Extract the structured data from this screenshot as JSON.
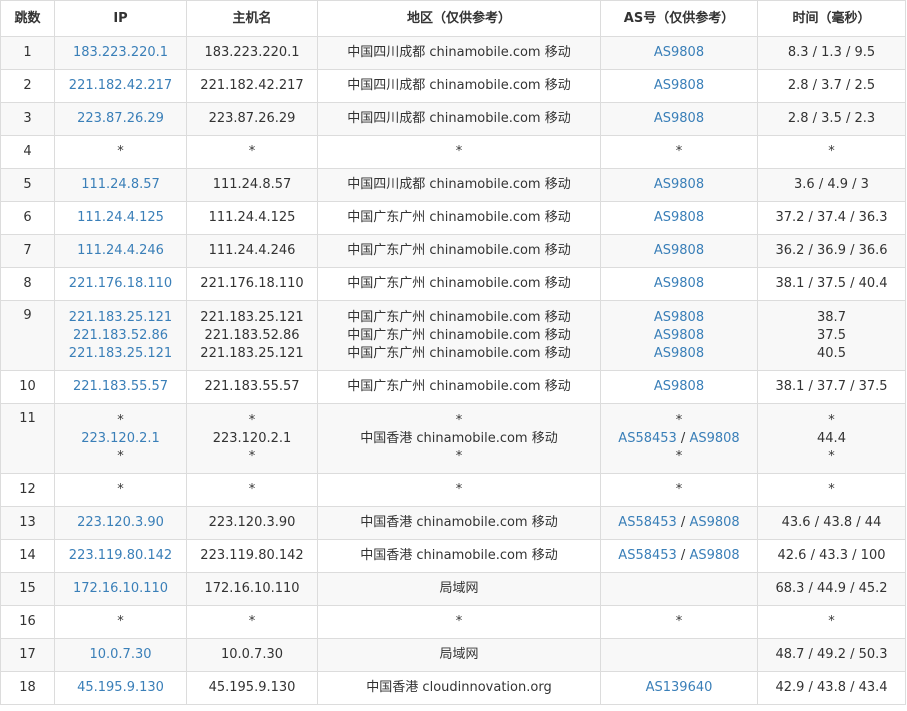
{
  "headers": [
    "跳数",
    "IP",
    "主机名",
    "地区（仅供参考）",
    "AS号（仅供参考）",
    "时间（毫秒）"
  ],
  "rows": [
    {
      "hop": "1",
      "lines": [
        {
          "ip": "183.223.220.1",
          "host": "183.223.220.1",
          "region": "中国四川成都 chinamobile.com 移动",
          "as": [
            "AS9808"
          ],
          "time": "8.3 / 1.3 / 9.5"
        }
      ]
    },
    {
      "hop": "2",
      "lines": [
        {
          "ip": "221.182.42.217",
          "host": "221.182.42.217",
          "region": "中国四川成都 chinamobile.com 移动",
          "as": [
            "AS9808"
          ],
          "time": "2.8 / 3.7 / 2.5"
        }
      ]
    },
    {
      "hop": "3",
      "lines": [
        {
          "ip": "223.87.26.29",
          "host": "223.87.26.29",
          "region": "中国四川成都 chinamobile.com 移动",
          "as": [
            "AS9808"
          ],
          "time": "2.8 / 3.5 / 2.3"
        }
      ]
    },
    {
      "hop": "4",
      "lines": [
        {
          "ip": "*",
          "host": "*",
          "region": "*",
          "as": [
            "*"
          ],
          "time": "*"
        }
      ]
    },
    {
      "hop": "5",
      "lines": [
        {
          "ip": "111.24.8.57",
          "host": "111.24.8.57",
          "region": "中国四川成都 chinamobile.com 移动",
          "as": [
            "AS9808"
          ],
          "time": "3.6 / 4.9 / 3"
        }
      ]
    },
    {
      "hop": "6",
      "lines": [
        {
          "ip": "111.24.4.125",
          "host": "111.24.4.125",
          "region": "中国广东广州 chinamobile.com 移动",
          "as": [
            "AS9808"
          ],
          "time": "37.2 / 37.4 / 36.3"
        }
      ]
    },
    {
      "hop": "7",
      "lines": [
        {
          "ip": "111.24.4.246",
          "host": "111.24.4.246",
          "region": "中国广东广州 chinamobile.com 移动",
          "as": [
            "AS9808"
          ],
          "time": "36.2 / 36.9 / 36.6"
        }
      ]
    },
    {
      "hop": "8",
      "lines": [
        {
          "ip": "221.176.18.110",
          "host": "221.176.18.110",
          "region": "中国广东广州 chinamobile.com 移动",
          "as": [
            "AS9808"
          ],
          "time": "38.1 / 37.5 / 40.4"
        }
      ]
    },
    {
      "hop": "9",
      "lines": [
        {
          "ip": "221.183.25.121",
          "host": "221.183.25.121",
          "region": "中国广东广州 chinamobile.com 移动",
          "as": [
            "AS9808"
          ],
          "time": "38.7"
        },
        {
          "ip": "221.183.52.86",
          "host": "221.183.52.86",
          "region": "中国广东广州 chinamobile.com 移动",
          "as": [
            "AS9808"
          ],
          "time": "37.5"
        },
        {
          "ip": "221.183.25.121",
          "host": "221.183.25.121",
          "region": "中国广东广州 chinamobile.com 移动",
          "as": [
            "AS9808"
          ],
          "time": "40.5"
        }
      ]
    },
    {
      "hop": "10",
      "lines": [
        {
          "ip": "221.183.55.57",
          "host": "221.183.55.57",
          "region": "中国广东广州 chinamobile.com 移动",
          "as": [
            "AS9808"
          ],
          "time": "38.1 / 37.7 / 37.5"
        }
      ]
    },
    {
      "hop": "11",
      "lines": [
        {
          "ip": "*",
          "host": "*",
          "region": "*",
          "as": [
            "*"
          ],
          "time": "*"
        },
        {
          "ip": "223.120.2.1",
          "host": "223.120.2.1",
          "region": "中国香港 chinamobile.com 移动",
          "as": [
            "AS58453",
            "AS9808"
          ],
          "time": "44.4"
        },
        {
          "ip": "*",
          "host": "*",
          "region": "*",
          "as": [
            "*"
          ],
          "time": "*"
        }
      ]
    },
    {
      "hop": "12",
      "lines": [
        {
          "ip": "*",
          "host": "*",
          "region": "*",
          "as": [
            "*"
          ],
          "time": "*"
        }
      ]
    },
    {
      "hop": "13",
      "lines": [
        {
          "ip": "223.120.3.90",
          "host": "223.120.3.90",
          "region": "中国香港 chinamobile.com 移动",
          "as": [
            "AS58453",
            "AS9808"
          ],
          "time": "43.6 / 43.8 / 44"
        }
      ]
    },
    {
      "hop": "14",
      "lines": [
        {
          "ip": "223.119.80.142",
          "host": "223.119.80.142",
          "region": "中国香港 chinamobile.com 移动",
          "as": [
            "AS58453",
            "AS9808"
          ],
          "time": "42.6 / 43.3 / 100"
        }
      ]
    },
    {
      "hop": "15",
      "lines": [
        {
          "ip": "172.16.10.110",
          "host": "172.16.10.110",
          "region": "局域网",
          "as": [],
          "time": "68.3 / 44.9 / 45.2"
        }
      ]
    },
    {
      "hop": "16",
      "lines": [
        {
          "ip": "*",
          "host": "*",
          "region": "*",
          "as": [
            "*"
          ],
          "time": "*"
        }
      ]
    },
    {
      "hop": "17",
      "lines": [
        {
          "ip": "10.0.7.30",
          "host": "10.0.7.30",
          "region": "局域网",
          "as": [],
          "time": "48.7 / 49.2 / 50.3"
        }
      ]
    },
    {
      "hop": "18",
      "lines": [
        {
          "ip": "45.195.9.130",
          "host": "45.195.9.130",
          "region": "中国香港 cloudinnovation.org",
          "as": [
            "AS139640"
          ],
          "time": "42.9 / 43.8 / 43.4"
        }
      ]
    }
  ],
  "colors": {
    "link": "#3a7fb8",
    "text": "#333333",
    "border": "#dcdcdc",
    "stripe": "#f8f8f8"
  }
}
